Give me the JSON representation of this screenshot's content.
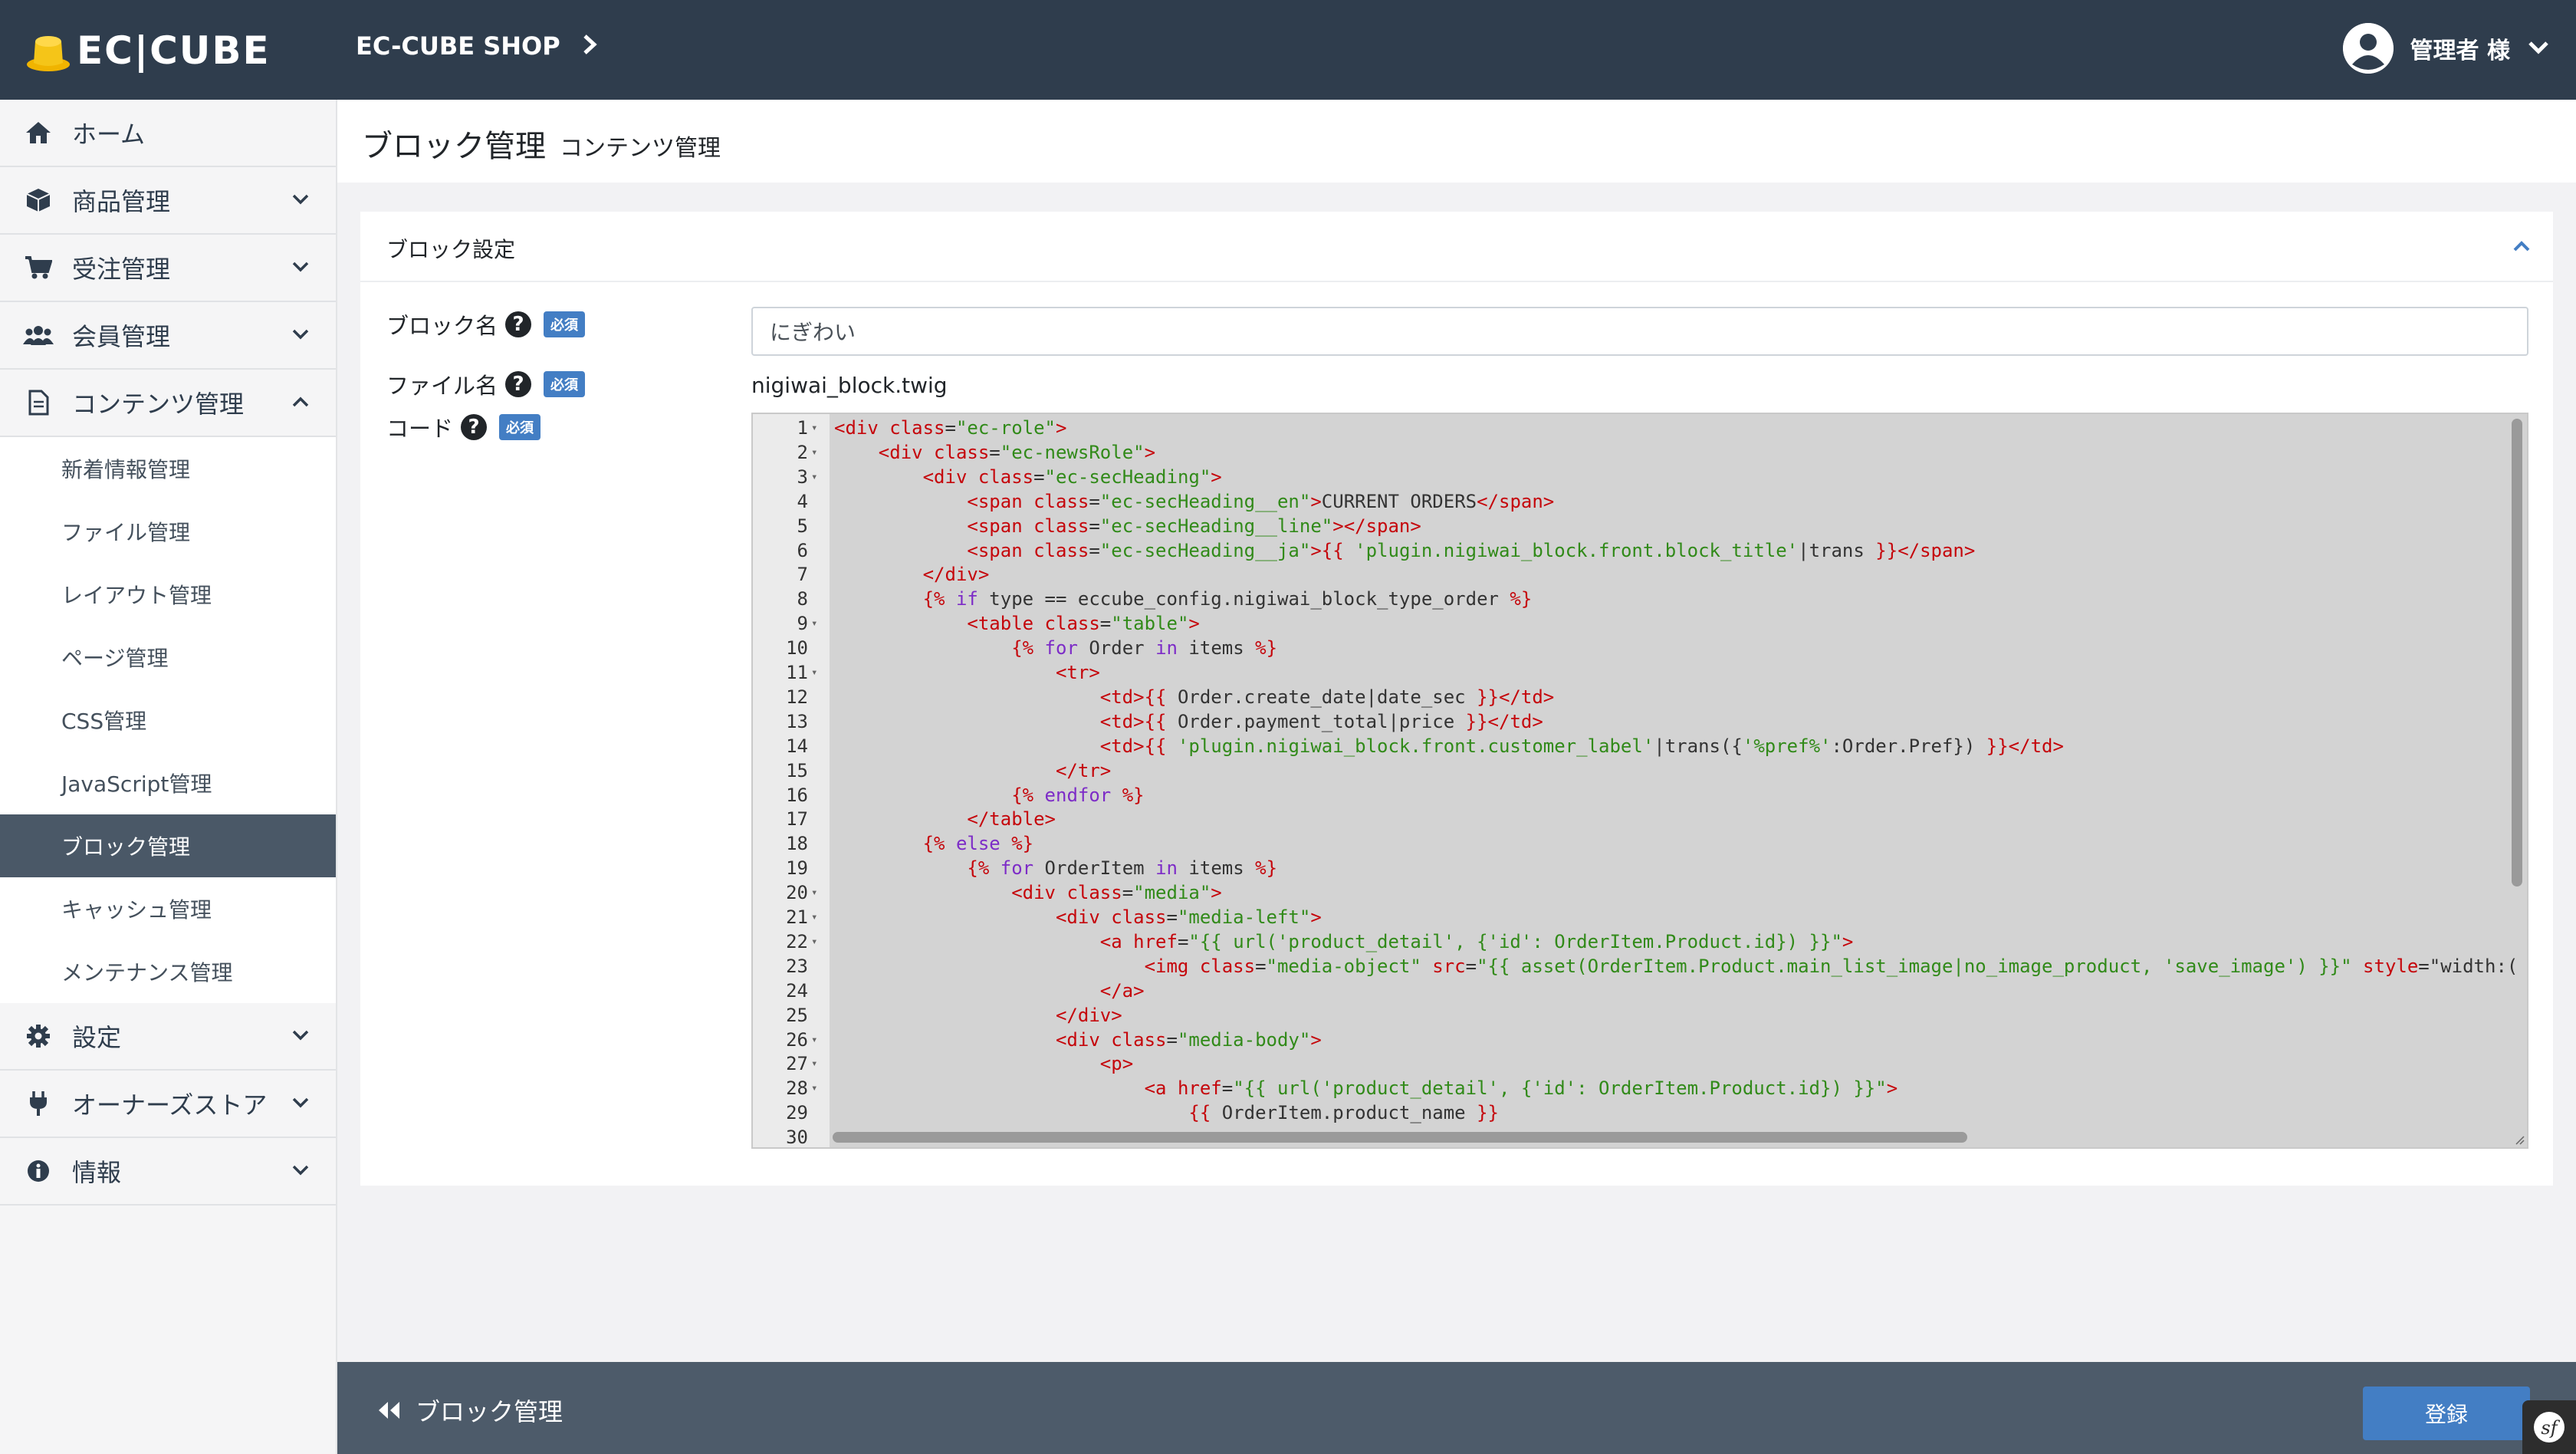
{
  "header": {
    "logo_text": "EC|CUBE",
    "shop_name": "EC-CUBE SHOP",
    "user_label": "管理者 様"
  },
  "sidebar": {
    "items": [
      {
        "label": "ホーム",
        "icon": "home-icon"
      },
      {
        "label": "商品管理",
        "icon": "box-icon"
      },
      {
        "label": "受注管理",
        "icon": "cart-icon"
      },
      {
        "label": "会員管理",
        "icon": "users-icon"
      },
      {
        "label": "コンテンツ管理",
        "icon": "file-icon"
      }
    ],
    "content_sub": [
      "新着情報管理",
      "ファイル管理",
      "レイアウト管理",
      "ページ管理",
      "CSS管理",
      "JavaScript管理",
      "ブロック管理",
      "キャッシュ管理",
      "メンテナンス管理"
    ],
    "bottom_items": [
      {
        "label": "設定",
        "icon": "gear-icon"
      },
      {
        "label": "オーナーズストア",
        "icon": "plug-icon"
      },
      {
        "label": "情報",
        "icon": "info-icon"
      }
    ]
  },
  "page": {
    "title": "ブロック管理",
    "subtitle": "コンテンツ管理"
  },
  "card": {
    "title": "ブロック設定",
    "fields": {
      "block_name_label": "ブロック名",
      "file_name_label": "ファイル名",
      "code_label": "コード",
      "required_badge": "必須",
      "block_name_value": "にぎわい",
      "file_name_value": "nigiwai_block.twig"
    }
  },
  "code_lines": [
    "<div class=\"ec-role\">",
    "    <div class=\"ec-newsRole\">",
    "        <div class=\"ec-secHeading\">",
    "            <span class=\"ec-secHeading__en\">CURRENT ORDERS</span>",
    "            <span class=\"ec-secHeading__line\"></span>",
    "            <span class=\"ec-secHeading__ja\">{{ 'plugin.nigiwai_block.front.block_title'|trans }}</span>",
    "        </div>",
    "        {% if type == eccube_config.nigiwai_block_type_order %}",
    "            <table class=\"table\">",
    "                {% for Order in items %}",
    "                    <tr>",
    "                        <td>{{ Order.create_date|date_sec }}</td>",
    "                        <td>{{ Order.payment_total|price }}</td>",
    "                        <td>{{ 'plugin.nigiwai_block.front.customer_label'|trans({'%pref%':Order.Pref}) }}</td>",
    "                    </tr>",
    "                {% endfor %}",
    "            </table>",
    "        {% else %}",
    "            {% for OrderItem in items %}",
    "                <div class=\"media\">",
    "                    <div class=\"media-left\">",
    "                        <a href=\"{{ url('product_detail', {'id': OrderItem.Product.id}) }}\">",
    "                            <img class=\"media-object\" src=\"{{ asset(OrderItem.Product.main_list_image|no_image_product, 'save_image') }}\" style=\"width:(",
    "                        </a>",
    "                    </div>",
    "                    <div class=\"media-body\">",
    "                        <p>",
    "                            <a href=\"{{ url('product_detail', {'id': OrderItem.Product.id}) }}\">",
    "                                {{ OrderItem.product_name }}",
    ""
  ],
  "footer": {
    "back_label": "ブロック管理",
    "submit_label": "登録"
  },
  "colors": {
    "header_bg": "#2f3d4d",
    "accent": "#437ec4",
    "active_nav": "#4a5867"
  }
}
